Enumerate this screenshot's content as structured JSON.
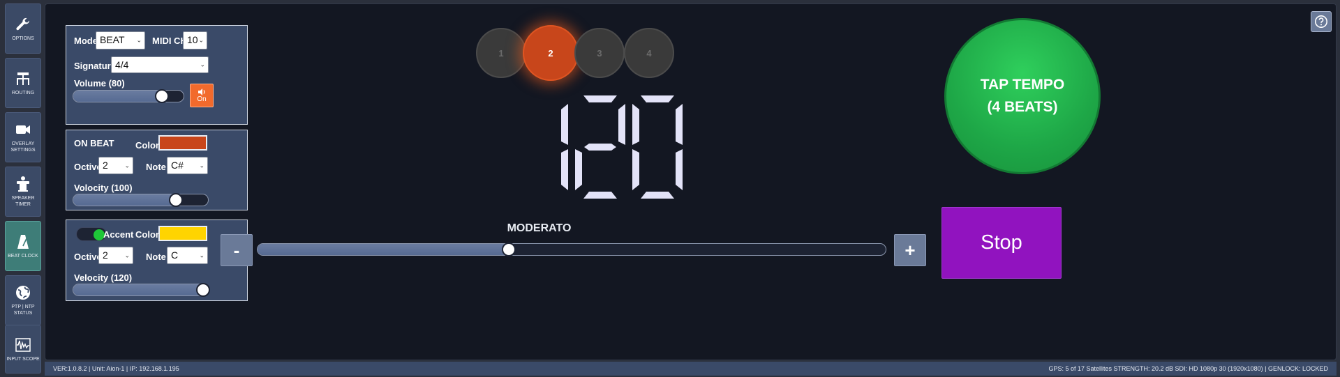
{
  "sidebar": {
    "items": [
      {
        "label": "OPTIONS",
        "icon": "wrench-icon"
      },
      {
        "label": "ROUTING",
        "icon": "routing-icon"
      },
      {
        "label": "OVERLAY SETTINGS",
        "icon": "video-camera-icon"
      },
      {
        "label": "SPEAKER TIMER",
        "icon": "podium-icon"
      },
      {
        "label": "BEAT CLOCK",
        "icon": "metronome-icon",
        "active": true
      },
      {
        "label": "PTP | NTP STATUS",
        "icon": "globe-icon"
      },
      {
        "label": "INPUT SCOPE",
        "icon": "waveform-icon"
      }
    ]
  },
  "settings": {
    "mode_label": "Mode",
    "mode_value": "BEAT",
    "midi_ch_label": "MIDI CH",
    "midi_ch_value": "10",
    "signature_label": "Signature",
    "signature_value": "4/4",
    "volume_label": "Volume (80)",
    "volume_level": 0.8,
    "mute_label": "On"
  },
  "on_beat": {
    "title": "ON BEAT",
    "color_label": "Color",
    "color": "#c8461b",
    "octive_label": "Octive",
    "octive_value": "2",
    "note_label": "Note",
    "note_value": "C#",
    "velocity_label": "Volocity (100)",
    "velocity_level": 0.76
  },
  "accent": {
    "toggle_label": "Accent",
    "enabled": true,
    "color_label": "Color",
    "color": "#ffd400",
    "octive_label": "Octive",
    "octive_value": "2",
    "note_label": "Note",
    "note_value": "C",
    "velocity_label": "Velocity (120)",
    "velocity_level": 0.96
  },
  "beats": [
    {
      "label": "1",
      "active": false
    },
    {
      "label": "2",
      "active": true
    },
    {
      "label": "3",
      "active": false
    },
    {
      "label": "4",
      "active": false
    }
  ],
  "tempo": {
    "bpm": "120",
    "name": "MODERATO",
    "slider_level": 0.4,
    "minus_label": "-",
    "plus_label": "+"
  },
  "tap": {
    "line1": "TAP TEMPO",
    "line2": "(4 BEATS)"
  },
  "stop_label": "Stop",
  "help_icon": "question-circle-icon",
  "status": {
    "left": "VER:1.0.8.2 | Unit: Aion-1 | IP: 192.168.1.195",
    "right": "GPS: 5 of 17 Satellites STRENGTH: 20.2 dB   SDI: HD 1080p 30 (1920x1080) | GENLOCK: LOCKED"
  }
}
